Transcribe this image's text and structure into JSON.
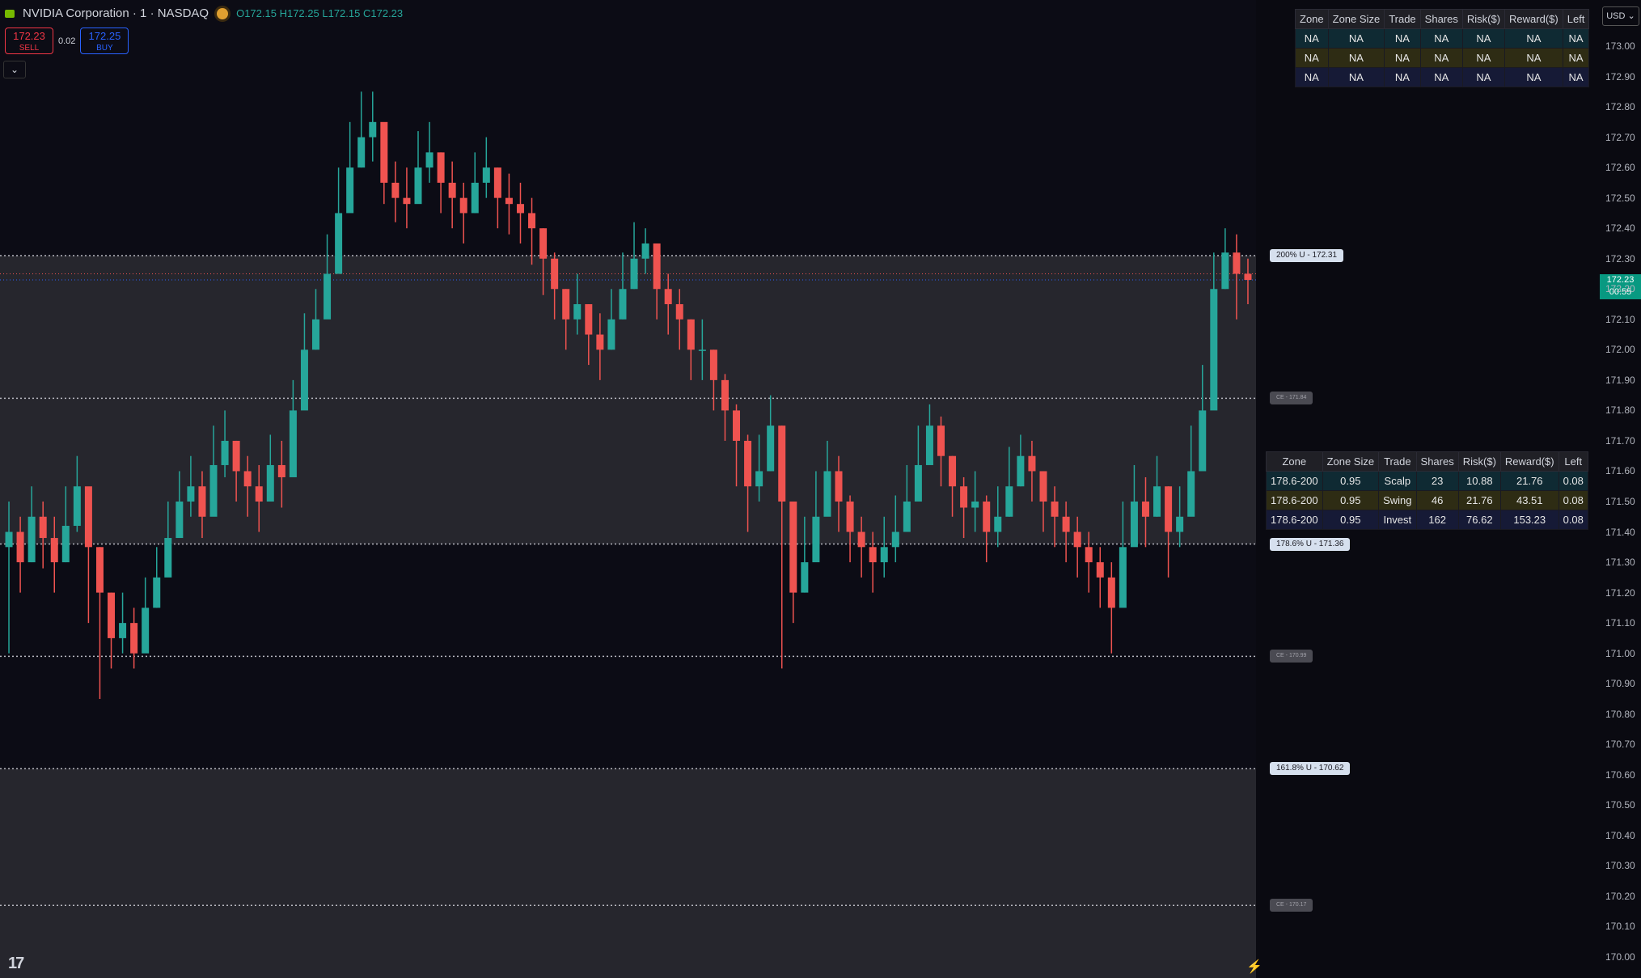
{
  "header": {
    "symbol": "NVIDIA Corporation · 1 · NASDAQ",
    "open": "O172.15",
    "high": "H172.25",
    "low": "L172.15",
    "close": "C172.23",
    "sell_price": "172.23",
    "sell_label": "SELL",
    "spread": "0.02",
    "buy_price": "172.25",
    "buy_label": "BUY",
    "collapse_icon": "chevron-down-icon"
  },
  "currency": "USD",
  "current_price": {
    "price": "172.23",
    "countdown": "00:55"
  },
  "table_top": {
    "headers": [
      "Zone",
      "Zone Size",
      "Trade",
      "Shares",
      "Risk($)",
      "Reward($)",
      "Left"
    ],
    "rows": [
      [
        "NA",
        "NA",
        "NA",
        "NA",
        "NA",
        "NA",
        "NA"
      ],
      [
        "NA",
        "NA",
        "NA",
        "NA",
        "NA",
        "NA",
        "NA"
      ],
      [
        "NA",
        "NA",
        "NA",
        "NA",
        "NA",
        "NA",
        "NA"
      ]
    ]
  },
  "table_mid": {
    "headers": [
      "Zone",
      "Zone Size",
      "Trade",
      "Shares",
      "Risk($)",
      "Reward($)",
      "Left"
    ],
    "rows": [
      [
        "178.6-200",
        "0.95",
        "Scalp",
        "23",
        "10.88",
        "21.76",
        "0.08"
      ],
      [
        "178.6-200",
        "0.95",
        "Swing",
        "46",
        "21.76",
        "43.51",
        "0.08"
      ],
      [
        "178.6-200",
        "0.95",
        "Invest",
        "162",
        "76.62",
        "153.23",
        "0.08"
      ]
    ]
  },
  "levels": [
    {
      "label": "200% U - 172.31",
      "price": 172.31,
      "kind": "u"
    },
    {
      "label": "CE - 171.84",
      "price": 171.84,
      "kind": "c"
    },
    {
      "label": "178.6% U - 171.36",
      "price": 171.36,
      "kind": "u"
    },
    {
      "label": "CE - 170.99",
      "price": 170.99,
      "kind": "c"
    },
    {
      "label": "161.8% U - 170.62",
      "price": 170.62,
      "kind": "u"
    },
    {
      "label": "CE - 170.17",
      "price": 170.17,
      "kind": "c"
    }
  ],
  "y_axis": [
    "173.00",
    "172.90",
    "172.80",
    "172.70",
    "172.60",
    "172.50",
    "172.40",
    "172.30",
    "172.20",
    "172.10",
    "172.00",
    "171.90",
    "171.80",
    "171.70",
    "171.60",
    "171.50",
    "171.40",
    "171.30",
    "171.20",
    "171.10",
    "171.00",
    "170.90",
    "170.80",
    "170.70",
    "170.60",
    "170.50",
    "170.40",
    "170.30",
    "170.20",
    "170.10",
    "170.00"
  ],
  "colors": {
    "up": "#26a69a",
    "down": "#ef5350",
    "zone_band": "#26262d",
    "background": "#0c0c15"
  },
  "chart_data": {
    "type": "candlestick",
    "ylim": [
      170.0,
      173.0
    ],
    "close": [
      171.4,
      171.3,
      171.45,
      171.38,
      171.3,
      171.42,
      171.55,
      171.35,
      171.2,
      171.05,
      171.1,
      171.0,
      171.15,
      171.25,
      171.38,
      171.5,
      171.55,
      171.45,
      171.62,
      171.7,
      171.6,
      171.55,
      171.5,
      171.62,
      171.58,
      171.8,
      172.0,
      172.1,
      172.25,
      172.45,
      172.6,
      172.7,
      172.75,
      172.55,
      172.5,
      172.48,
      172.6,
      172.65,
      172.55,
      172.5,
      172.45,
      172.55,
      172.6,
      172.5,
      172.48,
      172.45,
      172.4,
      172.3,
      172.2,
      172.1,
      172.15,
      172.05,
      172.0,
      172.1,
      172.2,
      172.3,
      172.35,
      172.2,
      172.15,
      172.1,
      172.0,
      172.0,
      171.9,
      171.8,
      171.7,
      171.55,
      171.6,
      171.75,
      171.5,
      171.2,
      171.3,
      171.45,
      171.6,
      171.5,
      171.4,
      171.35,
      171.3,
      171.35,
      171.4,
      171.5,
      171.62,
      171.75,
      171.65,
      171.55,
      171.48,
      171.5,
      171.4,
      171.45,
      171.55,
      171.65,
      171.6,
      171.5,
      171.45,
      171.4,
      171.35,
      171.3,
      171.25,
      171.15,
      171.35,
      171.5,
      171.45,
      171.55,
      171.4,
      171.45,
      171.6,
      171.8,
      172.2,
      172.32,
      172.25,
      172.23
    ],
    "high": [
      171.5,
      171.45,
      171.55,
      171.5,
      171.45,
      171.55,
      171.65,
      171.45,
      171.35,
      171.2,
      171.2,
      171.15,
      171.25,
      171.35,
      171.5,
      171.6,
      171.65,
      171.6,
      171.75,
      171.8,
      171.7,
      171.65,
      171.62,
      171.72,
      171.7,
      171.9,
      172.12,
      172.2,
      172.38,
      172.6,
      172.75,
      172.85,
      172.85,
      172.7,
      172.62,
      172.6,
      172.72,
      172.75,
      172.65,
      172.62,
      172.55,
      172.65,
      172.7,
      172.6,
      172.58,
      172.55,
      172.5,
      172.4,
      172.32,
      172.2,
      172.25,
      172.15,
      172.12,
      172.2,
      172.32,
      172.42,
      172.4,
      172.32,
      172.25,
      172.2,
      172.1,
      172.1,
      172.0,
      171.92,
      171.82,
      171.72,
      171.72,
      171.85,
      171.75,
      171.35,
      171.45,
      171.6,
      171.7,
      171.65,
      171.52,
      171.45,
      171.4,
      171.45,
      171.52,
      171.62,
      171.75,
      171.82,
      171.78,
      171.65,
      171.58,
      171.6,
      171.52,
      171.55,
      171.68,
      171.72,
      171.7,
      171.6,
      171.55,
      171.5,
      171.45,
      171.4,
      171.35,
      171.3,
      171.5,
      171.62,
      171.58,
      171.65,
      171.55,
      171.55,
      171.75,
      171.95,
      172.32,
      172.4,
      172.38,
      172.3
    ],
    "low": [
      171.0,
      171.2,
      171.3,
      171.28,
      171.2,
      171.3,
      171.4,
      171.1,
      170.85,
      170.95,
      171.0,
      170.95,
      171.05,
      171.15,
      171.28,
      171.4,
      171.45,
      171.38,
      171.5,
      171.58,
      171.5,
      171.45,
      171.4,
      171.5,
      171.48,
      171.7,
      171.9,
      172.0,
      172.15,
      172.35,
      172.5,
      172.6,
      172.62,
      172.48,
      172.42,
      172.4,
      172.5,
      172.55,
      172.45,
      172.4,
      172.35,
      172.45,
      172.5,
      172.4,
      172.38,
      172.35,
      172.28,
      172.18,
      172.1,
      172.0,
      172.05,
      171.95,
      171.9,
      172.0,
      172.1,
      172.2,
      172.25,
      172.1,
      172.05,
      172.0,
      171.9,
      171.9,
      171.8,
      171.7,
      171.55,
      171.4,
      171.5,
      171.6,
      170.95,
      171.1,
      171.2,
      171.35,
      171.5,
      171.4,
      171.3,
      171.25,
      171.2,
      171.25,
      171.3,
      171.4,
      171.55,
      171.65,
      171.55,
      171.45,
      171.38,
      171.4,
      171.3,
      171.35,
      171.45,
      171.55,
      171.5,
      171.4,
      171.35,
      171.3,
      171.25,
      171.2,
      171.15,
      171.0,
      171.25,
      171.4,
      171.35,
      171.45,
      171.25,
      171.35,
      171.5,
      171.7,
      171.9,
      172.2,
      172.1,
      172.15
    ]
  }
}
